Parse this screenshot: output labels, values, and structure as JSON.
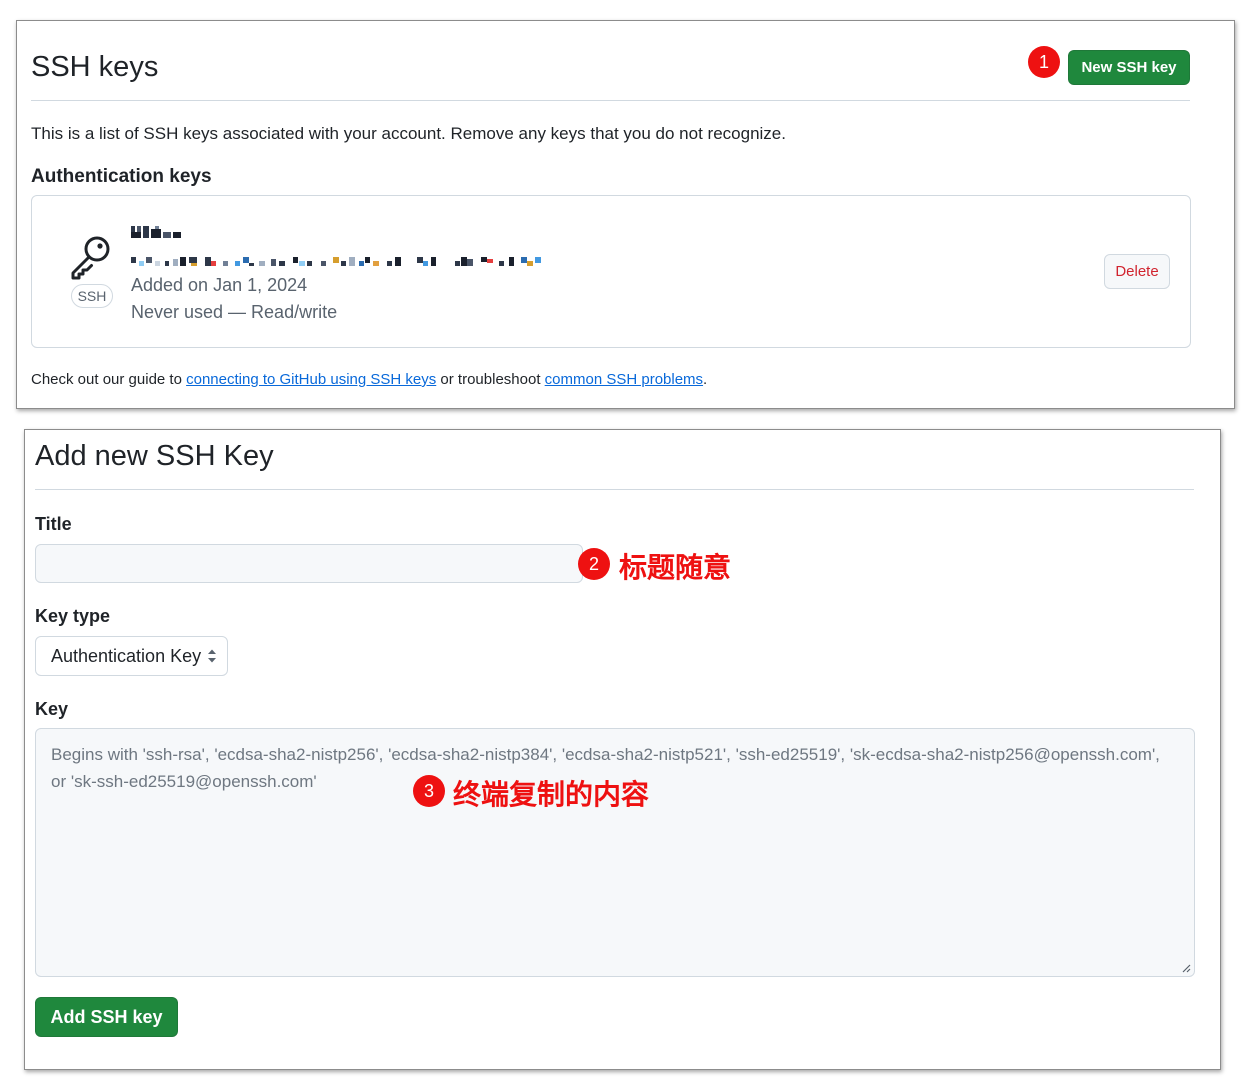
{
  "ssh_keys": {
    "title": "SSH keys",
    "new_key_button": "New SSH key",
    "intro": "This is a list of SSH keys associated with your account. Remove any keys that you do not recognize.",
    "auth_heading": "Authentication keys",
    "key_entry": {
      "badge": "SSH",
      "added": "Added on Jan 1, 2024",
      "usage": "Never used — Read/write",
      "delete_button": "Delete"
    },
    "guide": {
      "prefix": "Check out our guide to ",
      "link1": "connecting to GitHub using SSH keys",
      "middle": " or troubleshoot ",
      "link2": "common SSH problems",
      "suffix": "."
    }
  },
  "add_key": {
    "title": "Add new SSH Key",
    "title_label": "Title",
    "title_value": "",
    "type_label": "Key type",
    "type_selected": "Authentication Key",
    "key_label": "Key",
    "key_placeholder": "Begins with 'ssh-rsa', 'ecdsa-sha2-nistp256', 'ecdsa-sha2-nistp384', 'ecdsa-sha2-nistp521', 'ssh-ed25519', 'sk-ecdsa-sha2-nistp256@openssh.com', or 'sk-ssh-ed25519@openssh.com'",
    "submit_button": "Add SSH key"
  },
  "annotations": {
    "marker1": "1",
    "marker2": "2",
    "marker3": "3",
    "note2": "标题随意",
    "note3": "终端复制的内容"
  },
  "colors": {
    "accent_green": "#1f883d",
    "danger_red": "#d1242f",
    "annotation_red": "#ee1111",
    "link_blue": "#0969da"
  },
  "icons": {
    "key": "key-icon",
    "select_arrows": "chevron-updown-icon",
    "resize": "resize-handle-icon"
  }
}
